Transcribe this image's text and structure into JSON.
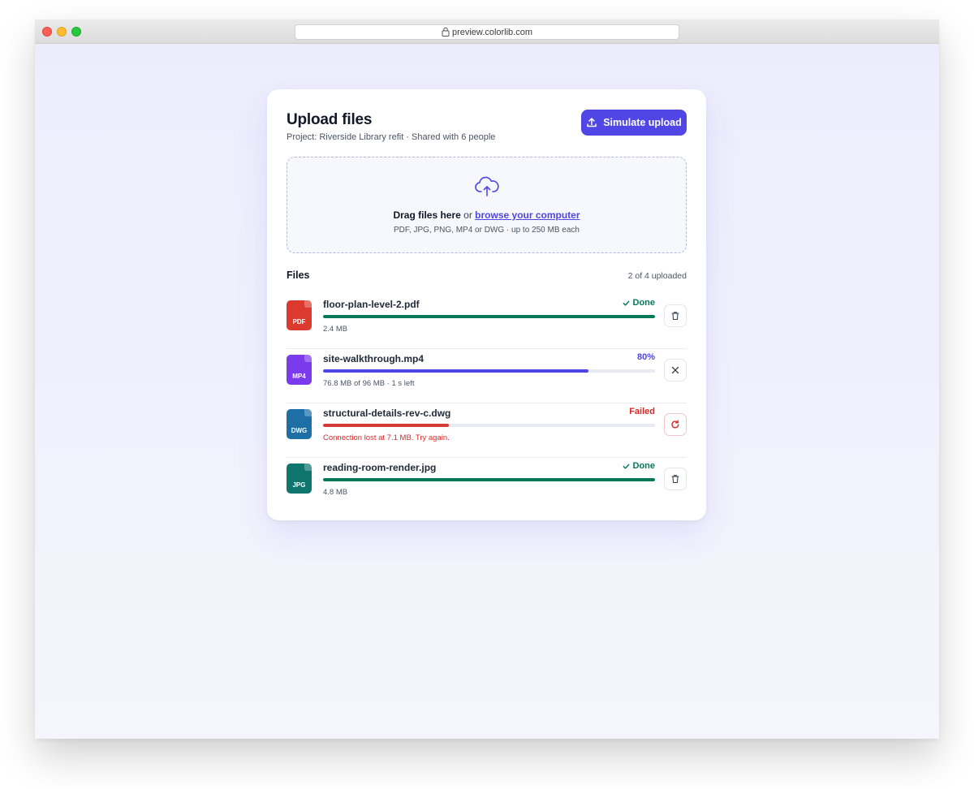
{
  "browser": {
    "url": "preview.colorlib.com"
  },
  "colors": {
    "accent": "#4f46e5",
    "success": "#047857",
    "error": "#dc2626",
    "muted_track": "#e8ebf3"
  },
  "upload": {
    "title": "Upload files",
    "subtitle": "Project: Riverside Library refit · Shared with 6 people",
    "simulate_button": "Simulate upload",
    "simulate_icon": "upload-icon"
  },
  "dropzone": {
    "icon": "cloud-upload-icon",
    "lead_text": "Drag files here",
    "or_text": " or ",
    "link_text": "browse your computer",
    "hint": "PDF, JPG, PNG, MP4 or DWG · up to 250 MB each"
  },
  "files": {
    "heading": "Files",
    "count_text": "2 of 4 uploaded",
    "items": [
      {
        "type_label": "PDF",
        "type_color": "#dc3a2f",
        "name": "floor-plan-level-2.pdf",
        "status": "Done",
        "status_icon": "check-icon",
        "status_color": "#047857",
        "progress": 1.0,
        "progress_color": "#047857",
        "meta": "2.4 MB",
        "action_icon": "trash-icon",
        "action_name": "delete-file-button"
      },
      {
        "type_label": "MP4",
        "type_color": "#7c3aed",
        "name": "site-walkthrough.mp4",
        "status": "80%",
        "status_icon": "",
        "status_color": "#4f46e5",
        "progress": 0.8,
        "progress_color": "#4f46e5",
        "meta": "76.8 MB of 96 MB · 1 s left",
        "action_icon": "close-icon",
        "action_name": "cancel-upload-button"
      },
      {
        "type_label": "DWG",
        "type_color": "#1d6fa5",
        "name": "structural-details-rev-c.dwg",
        "status": "Failed",
        "status_icon": "",
        "status_color": "#dc2626",
        "progress": 0.38,
        "progress_color": "#d13a35",
        "meta": "Connection lost at 7.1 MB. Try again.",
        "meta_error": true,
        "action_icon": "retry-icon",
        "action_name": "retry-upload-button"
      },
      {
        "type_label": "JPG",
        "type_color": "#0f766e",
        "name": "reading-room-render.jpg",
        "status": "Done",
        "status_icon": "check-icon",
        "status_color": "#047857",
        "progress": 1.0,
        "progress_color": "#047857",
        "meta": "4.8 MB",
        "action_icon": "trash-icon",
        "action_name": "delete-file-button"
      }
    ]
  }
}
